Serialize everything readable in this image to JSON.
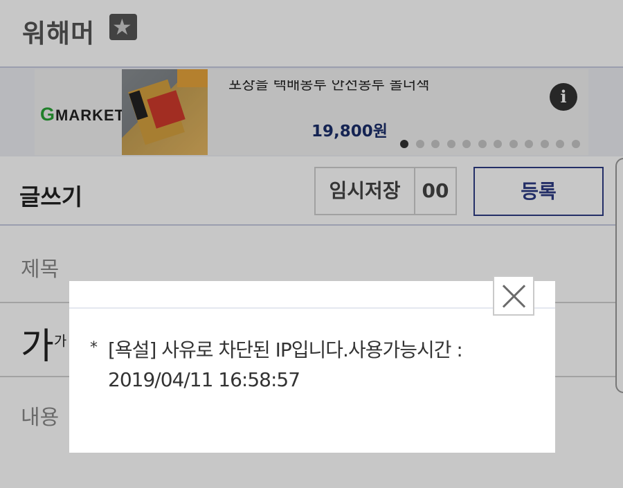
{
  "header": {
    "gallery_name": "워해머",
    "star_glyph": "★"
  },
  "ad": {
    "brand": "GMARKET",
    "brand_mark": "G",
    "brand_rest": "MARKET",
    "caption": "포장을 택배봉투 안전봉투 몰더책",
    "price": "19,800원",
    "info_glyph": "i",
    "slide_count": 12,
    "active_slide": 0
  },
  "writebar": {
    "title": "글쓰기",
    "temp_save_label": "임시저장",
    "temp_save_count": "00",
    "register_label": "등록"
  },
  "form": {
    "subject_label": "제목",
    "font_sample": "가",
    "font_sample_small": "가",
    "content_label": "내용"
  },
  "modal": {
    "bullet": "*",
    "message_line1": "[욕설] 사유로 차단된 IP입니다.사용가능시간 :",
    "message_line2": "2019/04/11 16:58:57"
  },
  "colors": {
    "brand_green": "#2aa337",
    "primary_navy": "#2e3b84",
    "price_navy": "#1b2f6b"
  }
}
